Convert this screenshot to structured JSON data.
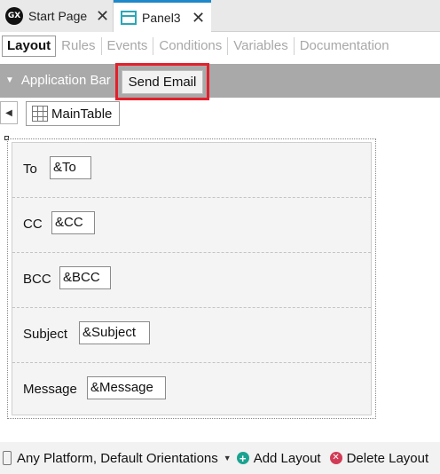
{
  "document_tabs": [
    {
      "label": "Start Page",
      "icon": "gx-logo-icon",
      "close": "✕"
    },
    {
      "label": "Panel3",
      "icon": "panel-icon",
      "close": "✕"
    }
  ],
  "gx_logo_text": "GX",
  "sub_tabs": [
    "Layout",
    "Rules",
    "Events",
    "Conditions",
    "Variables",
    "Documentation"
  ],
  "app_bar": {
    "title": "Application Bar",
    "button": "Send Email"
  },
  "main_table_label": "MainTable",
  "form_rows": [
    {
      "label": "To",
      "value": "&To"
    },
    {
      "label": "CC",
      "value": "&CC"
    },
    {
      "label": "BCC",
      "value": "&BCC"
    },
    {
      "label": "Subject",
      "value": "&Subject"
    },
    {
      "label": "Message",
      "value": "&Message"
    }
  ],
  "status_bar": {
    "platform": "Any Platform, Default Orientations",
    "add_layout": "Add Layout",
    "delete_layout": "Delete Layout"
  },
  "colors": {
    "tab_accent": "#1e88c9",
    "highlight": "#e3202b",
    "app_bar": "#a9a9a9",
    "add_icon": "#1aa390",
    "delete_icon": "#d23b56"
  }
}
